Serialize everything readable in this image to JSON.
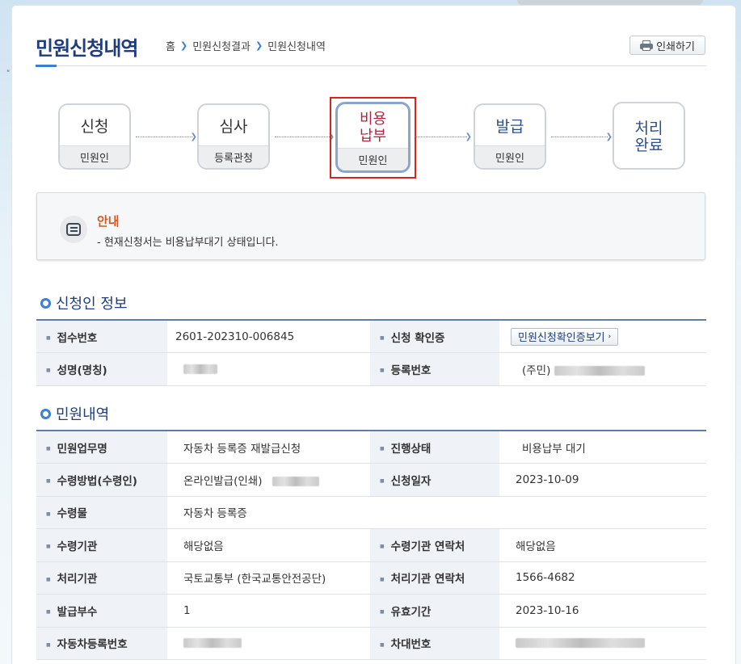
{
  "page": {
    "title": "민원신청내역",
    "print_label": "인쇄하기",
    "breadcrumb": [
      "홈",
      "민원신청결과",
      "민원신청내역"
    ]
  },
  "steps": [
    {
      "main": "신청",
      "sub": "민원인",
      "state": "done"
    },
    {
      "main": "심사",
      "sub": "등록관청",
      "state": "done"
    },
    {
      "main": "비용\n납부",
      "sub": "민원인",
      "state": "active"
    },
    {
      "main": "발급",
      "sub": "민원인",
      "state": "pending"
    },
    {
      "main": "처리\n완료",
      "sub": "",
      "state": "pending"
    }
  ],
  "notice": {
    "title": "안내",
    "text": "- 현재신청서는 비용납부대기 상태입니다."
  },
  "applicant": {
    "section_title": "신청인 정보",
    "receipt_no_label": "접수번호",
    "receipt_no": "2601-202310-006845",
    "confirm_label": "신청 확인증",
    "confirm_button": "민원신청확인증보기",
    "name_label": "성명(명칭)",
    "reg_no_label": "등록번호",
    "reg_no_prefix": "(주민)"
  },
  "petition": {
    "section_title": "민원내역",
    "work_name_label": "민원업무명",
    "work_name": "자동차 등록증 재발급신청",
    "status_label": "진행상태",
    "status": "비용납부 대기",
    "method_label": "수령방법(수령인)",
    "method": "온라인발급(인쇄)",
    "date_label": "신청일자",
    "date": "2023-10-09",
    "item_label": "수령물",
    "item": "자동차 등록증",
    "agency_label": "수령기관",
    "agency": "해당없음",
    "agency_contact_label": "수령기관 연락처",
    "agency_contact": "해당없음",
    "proc_label": "처리기관",
    "proc": "국토교통부 (한국교통안전공단)",
    "proc_contact_label": "처리기관 연락처",
    "proc_contact": "1566-4682",
    "copies_label": "발급부수",
    "copies": "1",
    "valid_label": "유효기간",
    "valid": "2023-10-16",
    "car_no_label": "자동차등록번호",
    "vin_label": "차대번호"
  },
  "colors": {
    "accent": "#1f3d7a",
    "active_step": "#b0243c",
    "highlight_frame": "#d9231e",
    "notice_title": "#d4581f"
  },
  "icons": [
    "printer-icon",
    "chevron-right-icon",
    "notice-icon",
    "section-bullet-icon"
  ]
}
